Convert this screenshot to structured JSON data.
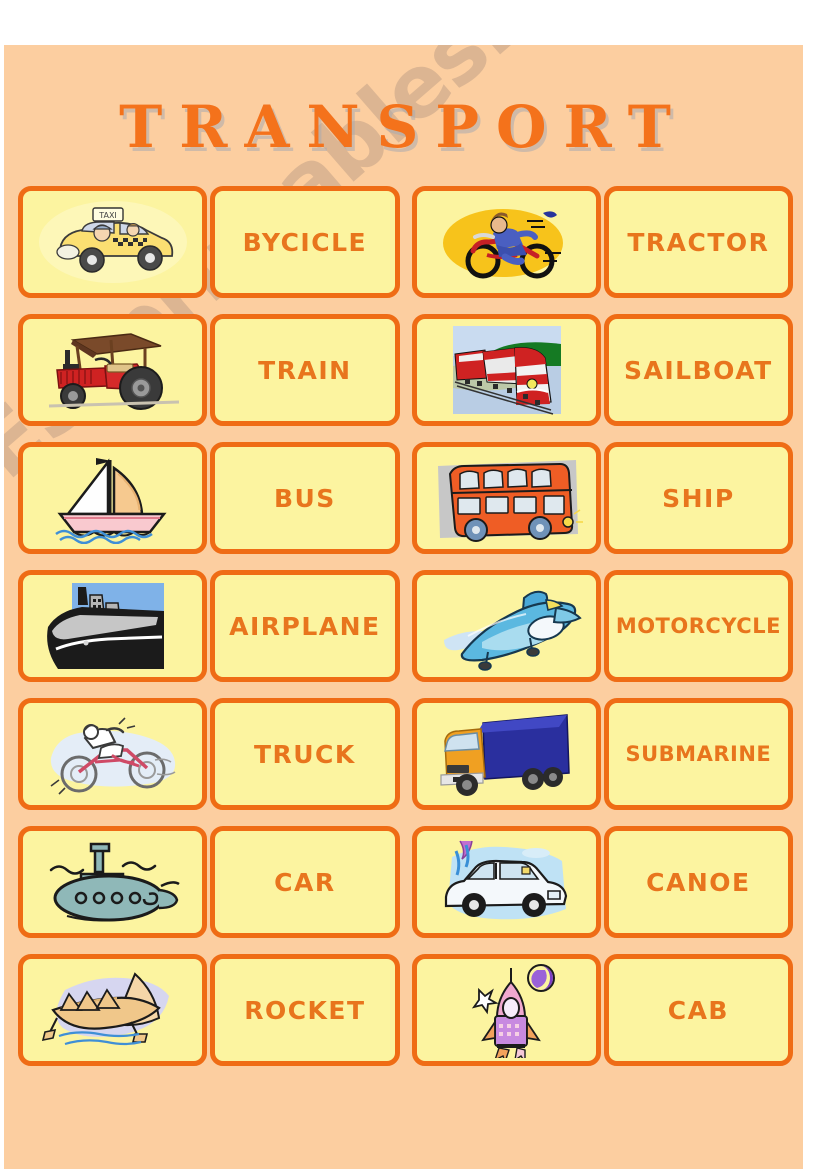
{
  "page": {
    "title": "TRANSPORT",
    "watermark": "ESLprintables.com",
    "background_color": "#fccea0",
    "card_fill_color": "#fcf4a0",
    "card_border_color": "#ef6c15",
    "word_color": "#e8751d",
    "title_color": "#f4721b"
  },
  "rows": [
    {
      "left": {
        "picture": "taxi-cab",
        "word": "BYCICLE"
      },
      "right": {
        "picture": "motorcycle-rider",
        "word": "TRACTOR"
      }
    },
    {
      "left": {
        "picture": "red-tractor",
        "word": "TRAIN"
      },
      "right": {
        "picture": "passenger-train",
        "word": "SAILBOAT"
      }
    },
    {
      "left": {
        "picture": "sailboat",
        "word": "BUS"
      },
      "right": {
        "picture": "double-decker-bus",
        "word": "SHIP"
      }
    },
    {
      "left": {
        "picture": "ocean-liner-ship",
        "word": "AIRPLANE"
      },
      "right": {
        "picture": "blue-airplane",
        "word": "MOTORCYCLE"
      }
    },
    {
      "left": {
        "picture": "dirt-motorcycle",
        "word": "TRUCK"
      },
      "right": {
        "picture": "delivery-truck",
        "word": "SUBMARINE"
      }
    },
    {
      "left": {
        "picture": "submarine",
        "word": "CAR"
      },
      "right": {
        "picture": "white-car",
        "word": "CANOE"
      }
    },
    {
      "left": {
        "picture": "canoe",
        "word": "ROCKET"
      },
      "right": {
        "picture": "rocket",
        "word": "CAB"
      }
    }
  ]
}
